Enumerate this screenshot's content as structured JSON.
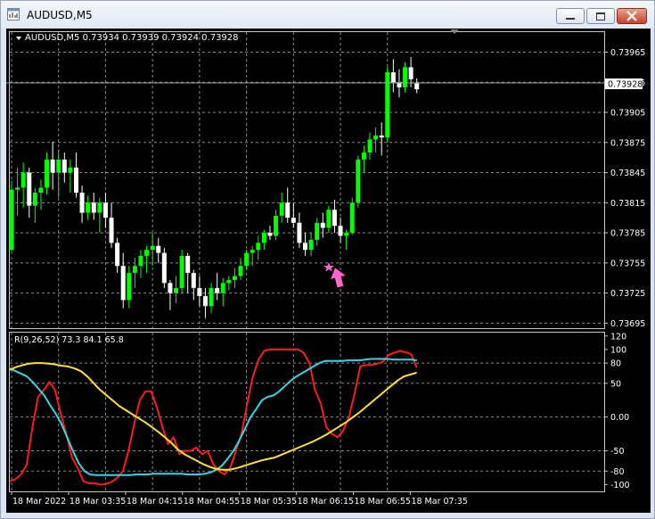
{
  "window": {
    "title": "AUDUSD,M5"
  },
  "price_chart": {
    "header": "AUDUSD,M5  0.73934 0.73939 0.73924 0.73928",
    "y_ticks": [
      "0.73965",
      "0.73935",
      "0.73905",
      "0.73875",
      "0.73845",
      "0.73815",
      "0.73785",
      "0.73755",
      "0.73725",
      "0.73695"
    ],
    "current_price": "0.73928"
  },
  "indicator": {
    "header": "R(9,26,52) 73.3 84.1 65.8",
    "y_ticks": [
      "120",
      "100",
      "80",
      "50",
      "0.00",
      "-50",
      "-80",
      "-100"
    ]
  },
  "x_ticks": [
    "18 Mar 2022",
    "18 Mar 03:35",
    "18 Mar 04:15",
    "18 Mar 04:55",
    "18 Mar 05:35",
    "18 Mar 06:15",
    "18 Mar 06:55",
    "18 Mar 07:35"
  ],
  "colors": {
    "background": "#000000",
    "bull_candle": "#00ff00",
    "bear_candle": "#ffffff",
    "rsi_fast": "#ff1a1a",
    "rsi_mid": "#33d6e6",
    "rsi_slow": "#ffe033",
    "arrow": "#ff66cc"
  },
  "icons": {
    "app": "chart-window-icon",
    "signal": "buy-arrow-icon"
  },
  "chart_data": [
    {
      "type": "candlestick",
      "title": "AUDUSD,M5",
      "ylim": [
        0.7369,
        0.73985
      ],
      "series": [
        {
          "name": "AUDUSD",
          "ohlc": [
            [
              0.73768,
              0.73837,
              0.73765,
              0.73828
            ],
            [
              0.73828,
              0.7385,
              0.73802,
              0.7383
            ],
            [
              0.7383,
              0.73855,
              0.7381,
              0.73845
            ],
            [
              0.73845,
              0.7385,
              0.738,
              0.73812
            ],
            [
              0.73812,
              0.7383,
              0.73795,
              0.73825
            ],
            [
              0.73825,
              0.73838,
              0.73808,
              0.7383
            ],
            [
              0.7383,
              0.73865,
              0.73823,
              0.73858
            ],
            [
              0.73858,
              0.73876,
              0.73828,
              0.73845
            ],
            [
              0.73845,
              0.73868,
              0.7382,
              0.73858
            ],
            [
              0.73858,
              0.73865,
              0.73835,
              0.73845
            ],
            [
              0.73845,
              0.73858,
              0.73825,
              0.7385
            ],
            [
              0.7385,
              0.73865,
              0.7382,
              0.73825
            ],
            [
              0.73825,
              0.73832,
              0.73795,
              0.73805
            ],
            [
              0.73805,
              0.73822,
              0.73798,
              0.73815
            ],
            [
              0.73815,
              0.73825,
              0.73798,
              0.73805
            ],
            [
              0.73805,
              0.7382,
              0.73785,
              0.73815
            ],
            [
              0.73815,
              0.73825,
              0.7379,
              0.738
            ],
            [
              0.738,
              0.73815,
              0.7377,
              0.73775
            ],
            [
              0.73775,
              0.7378,
              0.73745,
              0.73752
            ],
            [
              0.73752,
              0.73765,
              0.7371,
              0.73718
            ],
            [
              0.73718,
              0.73752,
              0.7371,
              0.73745
            ],
            [
              0.73745,
              0.7376,
              0.7373,
              0.73752
            ],
            [
              0.73752,
              0.73768,
              0.7374,
              0.73762
            ],
            [
              0.73762,
              0.73772,
              0.73745,
              0.73768
            ],
            [
              0.73768,
              0.73785,
              0.73752,
              0.73772
            ],
            [
              0.73772,
              0.7378,
              0.73755,
              0.73765
            ],
            [
              0.73765,
              0.7377,
              0.7373,
              0.73735
            ],
            [
              0.73735,
              0.73738,
              0.73708,
              0.73725
            ],
            [
              0.73725,
              0.73742,
              0.73715,
              0.7373
            ],
            [
              0.7373,
              0.73768,
              0.73725,
              0.73762
            ],
            [
              0.73762,
              0.73765,
              0.73725,
              0.73745
            ],
            [
              0.73745,
              0.73748,
              0.73718,
              0.7373
            ],
            [
              0.7373,
              0.73742,
              0.73712,
              0.73722
            ],
            [
              0.73722,
              0.7373,
              0.737,
              0.73712
            ],
            [
              0.73712,
              0.73735,
              0.73705,
              0.7373
            ],
            [
              0.7373,
              0.73745,
              0.73718,
              0.73725
            ],
            [
              0.73725,
              0.7374,
              0.73712,
              0.73735
            ],
            [
              0.73735,
              0.73742,
              0.73728,
              0.73738
            ],
            [
              0.73738,
              0.7375,
              0.7373,
              0.73742
            ],
            [
              0.73742,
              0.7376,
              0.73738,
              0.73752
            ],
            [
              0.73752,
              0.73768,
              0.73748,
              0.73765
            ],
            [
              0.73765,
              0.73772,
              0.73752,
              0.73768
            ],
            [
              0.73768,
              0.73782,
              0.73758,
              0.73775
            ],
            [
              0.73775,
              0.73788,
              0.73768,
              0.73785
            ],
            [
              0.73785,
              0.73792,
              0.73778,
              0.73782
            ],
            [
              0.73782,
              0.73808,
              0.73778,
              0.73802
            ],
            [
              0.73802,
              0.73825,
              0.73795,
              0.73815
            ],
            [
              0.73815,
              0.7383,
              0.73795,
              0.738
            ],
            [
              0.738,
              0.73815,
              0.7379,
              0.73795
            ],
            [
              0.73795,
              0.73805,
              0.7377,
              0.73775
            ],
            [
              0.73775,
              0.73785,
              0.73762,
              0.73768
            ],
            [
              0.73768,
              0.73785,
              0.73762,
              0.73778
            ],
            [
              0.73778,
              0.738,
              0.73772,
              0.73795
            ],
            [
              0.73795,
              0.73805,
              0.7378,
              0.7379
            ],
            [
              0.7379,
              0.73812,
              0.73785,
              0.73808
            ],
            [
              0.73808,
              0.73818,
              0.73785,
              0.73792
            ],
            [
              0.73792,
              0.738,
              0.73775,
              0.73782
            ],
            [
              0.73782,
              0.73788,
              0.73768,
              0.73785
            ],
            [
              0.73785,
              0.7382,
              0.73783,
              0.73815
            ],
            [
              0.73815,
              0.73862,
              0.7381,
              0.73858
            ],
            [
              0.73858,
              0.73872,
              0.73845,
              0.73865
            ],
            [
              0.73865,
              0.73885,
              0.73858,
              0.73878
            ],
            [
              0.73878,
              0.7389,
              0.73865,
              0.73882
            ],
            [
              0.73882,
              0.73895,
              0.73862,
              0.7388
            ],
            [
              0.7388,
              0.7395,
              0.73875,
              0.73945
            ],
            [
              0.73945,
              0.73958,
              0.73925,
              0.73935
            ],
            [
              0.73935,
              0.73948,
              0.7392,
              0.7393
            ],
            [
              0.7393,
              0.73955,
              0.73925,
              0.7395
            ],
            [
              0.7395,
              0.7396,
              0.7393,
              0.73938
            ],
            [
              0.73934,
              0.73939,
              0.73924,
              0.73928
            ]
          ]
        }
      ]
    },
    {
      "type": "line",
      "title": "R(9,26,52)",
      "ylim": [
        -110,
        125
      ],
      "series": [
        {
          "name": "R(9)",
          "values": [
            -95,
            -92,
            -85,
            -70,
            -15,
            30,
            40,
            52,
            40,
            5,
            -25,
            -60,
            -75,
            -95,
            -98,
            -98,
            -100,
            -99,
            -96,
            -90,
            -80,
            -50,
            -10,
            25,
            38,
            38,
            15,
            -15,
            -40,
            -30,
            -55,
            -50,
            -50,
            -45,
            -55,
            -50,
            -70,
            -80,
            -85,
            -75,
            -50,
            -25,
            20,
            60,
            85,
            98,
            100,
            100,
            100,
            100,
            100,
            100,
            95,
            80,
            40,
            20,
            -15,
            -25,
            -30,
            -20,
            0,
            35,
            75,
            77,
            77,
            79,
            82,
            92,
            95,
            98,
            96,
            93,
            73.3
          ]
        },
        {
          "name": "R(26)",
          "values": [
            72,
            68,
            64,
            60,
            52,
            42,
            32,
            18,
            5,
            -10,
            -30,
            -50,
            -68,
            -80,
            -85,
            -86,
            -86,
            -86,
            -86,
            -86,
            -86,
            -86,
            -85,
            -85,
            -85,
            -84,
            -84,
            -84,
            -84,
            -84,
            -84,
            -85,
            -85,
            -85,
            -84,
            -82,
            -78,
            -72,
            -62,
            -50,
            -35,
            -18,
            0,
            12,
            25,
            30,
            32,
            38,
            46,
            54,
            60,
            65,
            70,
            75,
            80,
            83,
            83,
            83,
            83,
            84,
            84,
            84,
            85,
            86,
            86,
            86,
            86,
            85,
            85,
            85,
            85,
            84.1
          ]
        },
        {
          "name": "R(52)",
          "values": [
            70,
            74,
            77,
            79,
            80,
            80,
            79,
            78,
            76,
            75,
            72,
            68,
            60,
            50,
            40,
            32,
            24,
            16,
            10,
            4,
            -2,
            -8,
            -15,
            -22,
            -30,
            -38,
            -48,
            -55,
            -60,
            -65,
            -70,
            -74,
            -77,
            -78,
            -78,
            -76,
            -73,
            -70,
            -67,
            -64,
            -62,
            -60,
            -56,
            -52,
            -48,
            -44,
            -40,
            -36,
            -31,
            -26,
            -20,
            -14,
            -8,
            -1,
            6,
            14,
            22,
            30,
            38,
            46,
            54,
            60,
            63,
            65.8
          ]
        }
      ]
    }
  ]
}
